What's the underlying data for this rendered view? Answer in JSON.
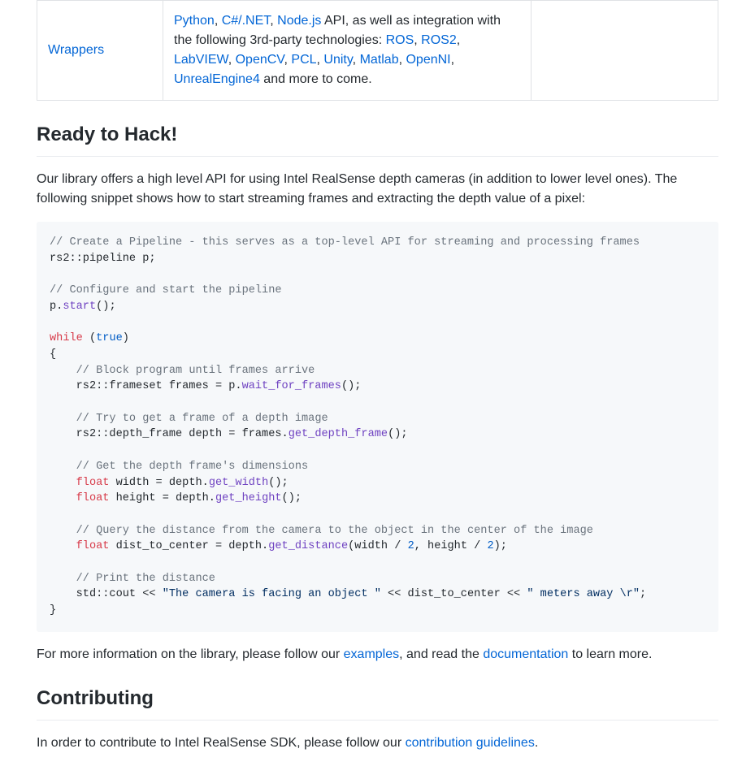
{
  "table": {
    "wrappers_label": "Wrappers",
    "desc_prefix_links": [
      {
        "text": "Python"
      },
      {
        "text": "C#/.NET"
      },
      {
        "text": "Node.js"
      }
    ],
    "desc_after_api": " API, as well as integration with the following 3rd-party technologies: ",
    "tech_links": [
      {
        "text": "ROS"
      },
      {
        "text": "ROS2"
      },
      {
        "text": "LabVIEW"
      },
      {
        "text": "OpenCV"
      },
      {
        "text": "PCL"
      },
      {
        "text": "Unity"
      },
      {
        "text": "Matlab"
      },
      {
        "text": "OpenNI"
      },
      {
        "text": "UnrealEngine4"
      }
    ],
    "desc_suffix": " and more to come."
  },
  "heading_ready": "Ready to Hack!",
  "intro_para": "Our library offers a high level API for using Intel RealSense depth cameras (in addition to lower level ones). The following snippet shows how to start streaming frames and extracting the depth value of a pixel:",
  "code": {
    "c1": "// Create a Pipeline - this serves as a top-level API for streaming and processing frames",
    "l1": "rs2::pipeline p;",
    "c2": "// Configure and start the pipeline",
    "l2a": "p.",
    "l2fn": "start",
    "l2b": "();",
    "kw_while": "while",
    "paren_open": " (",
    "kw_true": "true",
    "paren_close": ")",
    "brace_open": "{",
    "c3": "// Block program until frames arrive",
    "l3a": "    rs2::frameset frames = p.",
    "l3fn": "wait_for_frames",
    "l3b": "();",
    "c4": "// Try to get a frame of a depth image",
    "l4a": "    rs2::depth_frame depth = frames.",
    "l4fn": "get_depth_frame",
    "l4b": "();",
    "c5": "// Get the depth frame's dimensions",
    "kw_float": "float",
    "l5a": " width = depth.",
    "l5fn": "get_width",
    "l5b": "();",
    "l6a": " height = depth.",
    "l6fn": "get_height",
    "l6b": "();",
    "c6": "// Query the distance from the camera to the object in the center of the image",
    "l7a": " dist_to_center = depth.",
    "l7fn": "get_distance",
    "l7b": "(width / ",
    "num2a": "2",
    "l7c": ", height / ",
    "num2b": "2",
    "l7d": ");",
    "c7": "// Print the distance",
    "l8a": "    std::cout << ",
    "str1": "\"The camera is facing an object \"",
    "l8b": " << dist_to_center << ",
    "str2": "\" meters away \\r\"",
    "l8c": ";",
    "brace_close": "}"
  },
  "more_info_prefix": "For more information on the library, please follow our ",
  "examples_link": "examples",
  "more_info_mid": ", and read the ",
  "documentation_link": "documentation",
  "more_info_suffix": " to learn more.",
  "heading_contrib": "Contributing",
  "contrib_prefix": "In order to contribute to Intel RealSense SDK, please follow our ",
  "contrib_link": "contribution guidelines",
  "contrib_suffix": "."
}
